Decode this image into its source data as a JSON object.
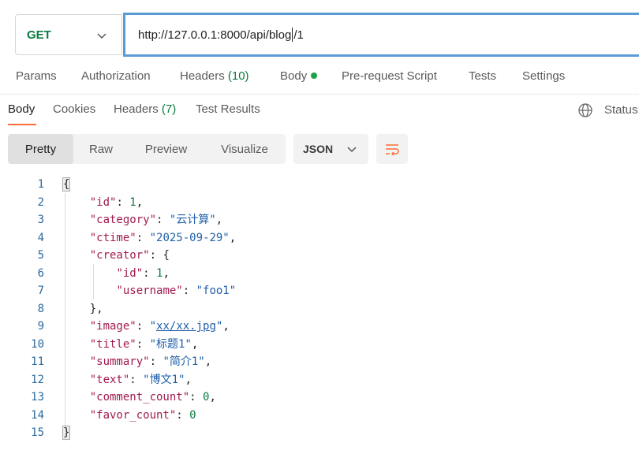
{
  "request": {
    "method": "GET",
    "url_before_cursor": "http://127.0.0.1:8000/api/blog",
    "url_after_cursor": "/1"
  },
  "request_tabs": {
    "params": "Params",
    "authorization": "Authorization",
    "headers": "Headers",
    "headers_count": "(10)",
    "body": "Body",
    "prerequest": "Pre-request Script",
    "tests": "Tests",
    "settings": "Settings"
  },
  "response_tabs": {
    "body": "Body",
    "cookies": "Cookies",
    "headers": "Headers",
    "headers_count": "(7)",
    "test_results": "Test Results",
    "status": "Status:"
  },
  "view_modes": {
    "pretty": "Pretty",
    "raw": "Raw",
    "preview": "Preview",
    "visualize": "Visualize",
    "format": "JSON"
  },
  "code": {
    "line_numbers": [
      "1",
      "2",
      "3",
      "4",
      "5",
      "6",
      "7",
      "8",
      "9",
      "10",
      "11",
      "12",
      "13",
      "14",
      "15"
    ],
    "open_brace": "{",
    "close_brace": "}",
    "id_key": "\"id\"",
    "id_val": "1",
    "category_key": "\"category\"",
    "category_val": "\"云计算\"",
    "ctime_key": "\"ctime\"",
    "ctime_val": "\"2025-09-29\"",
    "creator_key": "\"creator\"",
    "creator_open": "{",
    "creator_id_key": "\"id\"",
    "creator_id_val": "1",
    "username_key": "\"username\"",
    "username_val": "\"foo1\"",
    "creator_close": "}",
    "image_key": "\"image\"",
    "image_val_quote": "\"",
    "image_val_link": "xx/xx.jpg",
    "title_key": "\"title\"",
    "title_val": "\"标题1\"",
    "summary_key": "\"summary\"",
    "summary_val": "\"简介1\"",
    "text_key": "\"text\"",
    "text_val": "\"博文1\"",
    "comment_count_key": "\"comment_count\"",
    "comment_count_val": "0",
    "favor_count_key": "\"favor_count\"",
    "favor_count_val": "0"
  },
  "colors": {
    "method": "#0b7a3e",
    "json_key": "#a11b50",
    "json_string": "#1f5fa8",
    "json_number": "#0b7a3e",
    "accent": "#ff6c37"
  }
}
